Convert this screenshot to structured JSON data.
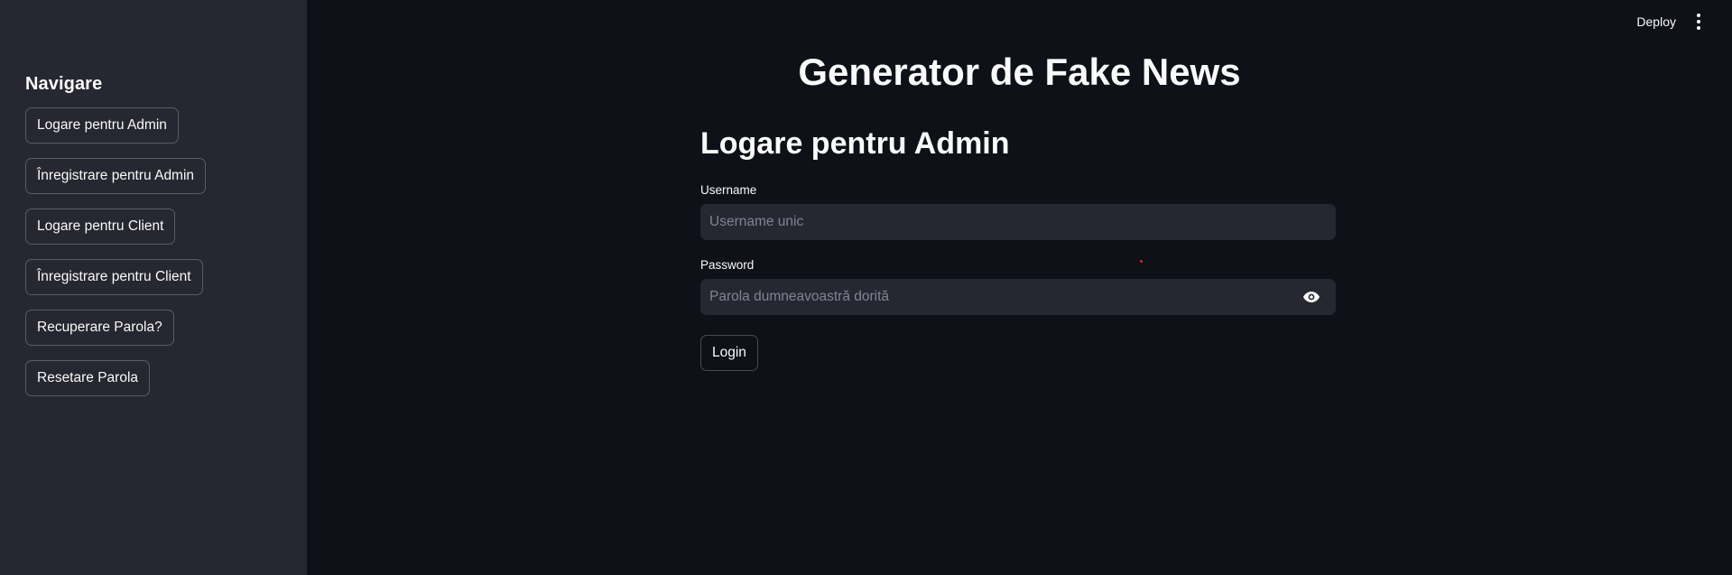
{
  "sidebar": {
    "title": "Navigare",
    "items": [
      {
        "label": "Logare pentru Admin"
      },
      {
        "label": "Înregistrare pentru Admin"
      },
      {
        "label": "Logare pentru Client"
      },
      {
        "label": "Înregistrare pentru Client"
      },
      {
        "label": "Recuperare Parola?"
      },
      {
        "label": "Resetare Parola"
      }
    ]
  },
  "header": {
    "deploy_label": "Deploy",
    "menu_icon": "vertical-dots-icon"
  },
  "main": {
    "title": "Generator de Fake News",
    "section_title": "Logare pentru Admin",
    "username": {
      "label": "Username",
      "placeholder": "Username unic",
      "value": ""
    },
    "password": {
      "label": "Password",
      "placeholder": "Parola dumneavoastră dorită",
      "value": "",
      "toggle_icon": "eye-icon"
    },
    "login_label": "Login"
  },
  "colors": {
    "background": "#0e1117",
    "sidebar": "#262730",
    "input": "#262730",
    "text": "#fafafa",
    "placeholder": "#808495"
  }
}
